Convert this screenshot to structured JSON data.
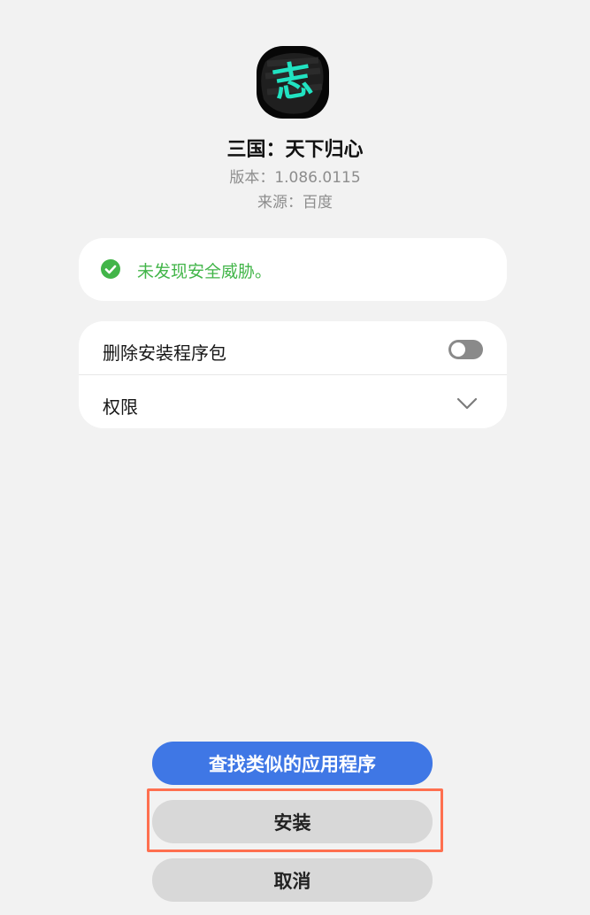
{
  "app": {
    "icon_name": "app-logo-icon",
    "name": "三国：天下归心",
    "version": "版本：1.086.0115",
    "source": "来源：百度"
  },
  "security": {
    "icon_name": "check-circle-icon",
    "status_text": "未发现安全威胁。",
    "status_color": "#42b549"
  },
  "settings": {
    "items": [
      {
        "label": "删除安装程序包",
        "control": "toggle",
        "enabled": false
      },
      {
        "label": "权限",
        "control": "chevron-down-icon"
      }
    ]
  },
  "actions": {
    "find_similar_label": "查找类似的应用程序",
    "install_label": "安装",
    "cancel_label": "取消",
    "primary_color": "#3f77e5",
    "highlight_color": "#ff6f4f"
  }
}
